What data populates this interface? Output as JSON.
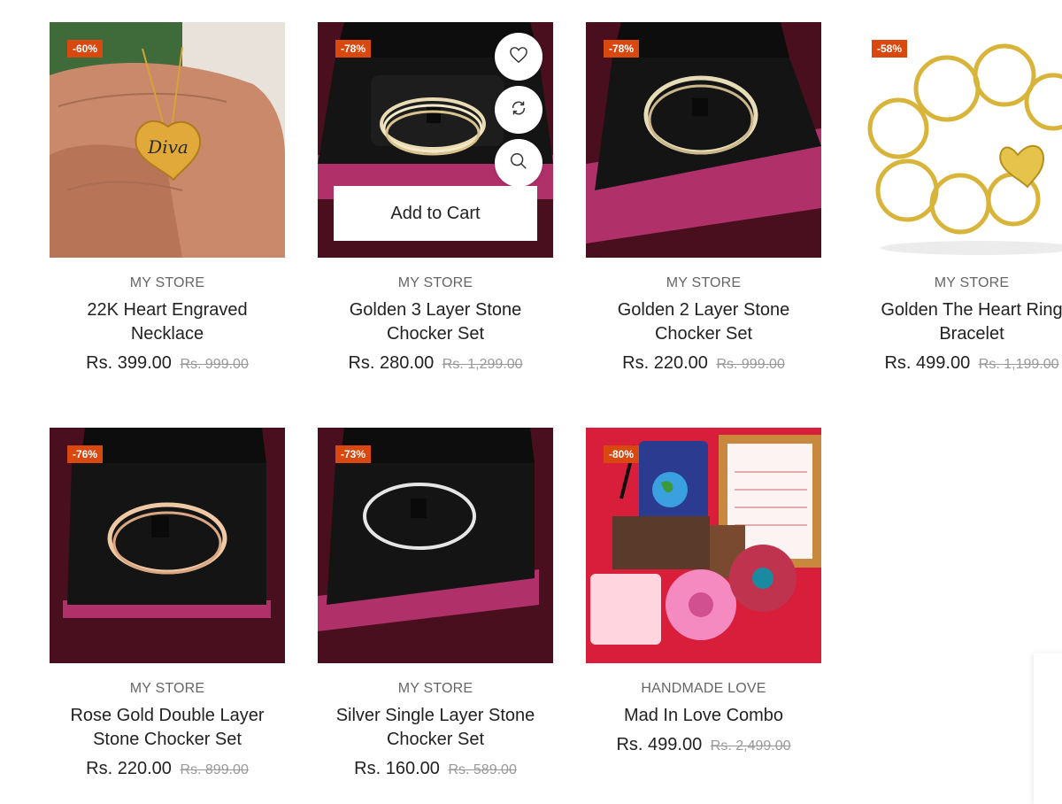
{
  "products": [
    {
      "badge": "-60%",
      "vendor": "MY STORE",
      "title": "22K Heart Engraved Necklace",
      "price": "Rs. 399.00",
      "compare": "Rs. 999.00",
      "image_text": "Diva"
    },
    {
      "badge": "-78%",
      "vendor": "MY STORE",
      "title": "Golden 3 Layer Stone Chocker Set",
      "price": "Rs. 280.00",
      "compare": "Rs. 1,299.00"
    },
    {
      "badge": "-78%",
      "vendor": "MY STORE",
      "title": "Golden 2 Layer Stone Chocker Set",
      "price": "Rs. 220.00",
      "compare": "Rs. 999.00"
    },
    {
      "badge": "-58%",
      "vendor": "MY STORE",
      "title": "Golden The Heart Ring Bracelet",
      "price": "Rs. 499.00",
      "compare": "Rs. 1,199.00"
    },
    {
      "badge": "-76%",
      "vendor": "MY STORE",
      "title": "Rose Gold Double Layer Stone Chocker Set",
      "price": "Rs. 220.00",
      "compare": "Rs. 899.00"
    },
    {
      "badge": "-73%",
      "vendor": "MY STORE",
      "title": "Silver Single Layer Stone Chocker Set",
      "price": "Rs. 160.00",
      "compare": "Rs. 589.00"
    },
    {
      "badge": "-80%",
      "vendor": "HANDMADE LOVE",
      "title": "Mad In Love Combo",
      "price": "Rs. 499.00",
      "compare": "Rs. 2,499.00"
    }
  ],
  "hover_actions": {
    "add_to_cart_label": "Add to Cart",
    "icons": [
      "heart-icon",
      "refresh-icon",
      "search-icon"
    ]
  },
  "colors": {
    "badge": "#d9480f",
    "velvet": "#4a0f1f",
    "box_pink": "#b0306a",
    "cushion": "#141414"
  }
}
